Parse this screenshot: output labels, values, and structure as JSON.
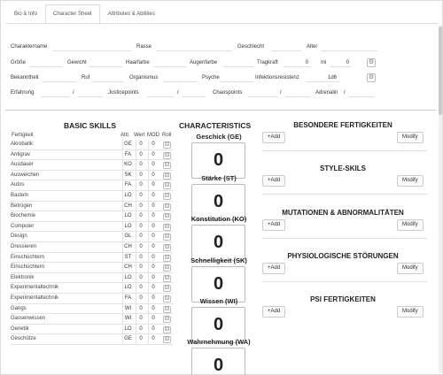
{
  "tabs": [
    "Bio & Info",
    "Character Sheet",
    "Attributes & Abilities"
  ],
  "fields": {
    "row1": [
      "Charaktername",
      "Rasse",
      "Geschlecht",
      "Alter"
    ],
    "row2": {
      "labels": [
        "Größe",
        "Gewicht",
        "Haarfarbe",
        "Augenfarbe",
        "Tragkraft",
        "Ini"
      ],
      "tragkraft_value": "0",
      "ini_value": "0"
    },
    "row3": {
      "labels": [
        "Bekanntheit",
        "Ruf",
        "Organismus",
        "Psyche",
        "Infektionsresistenz"
      ],
      "infektion_value": "1d6"
    },
    "row4": {
      "labels": [
        "Erfahrung",
        "Justicepoints",
        "Chaospoints",
        "Adrenalin"
      ],
      "slashes": [
        "/",
        "/",
        "/",
        "/"
      ]
    }
  },
  "basic_skills": {
    "title": "BASIC SKILLS",
    "columns": [
      "Fertigkeit",
      "Attr.",
      "Wert",
      "MOD",
      "Roll"
    ],
    "rows": [
      {
        "name": "Akrobatik",
        "attr": "GE",
        "wert": "0",
        "mod": "0"
      },
      {
        "name": "Antigrav",
        "attr": "FA",
        "wert": "0",
        "mod": "0"
      },
      {
        "name": "Ausdauer",
        "attr": "KO",
        "wert": "0",
        "mod": "0"
      },
      {
        "name": "Ausweichen",
        "attr": "SK",
        "wert": "0",
        "mod": "0"
      },
      {
        "name": "Autos",
        "attr": "FA",
        "wert": "0",
        "mod": "0"
      },
      {
        "name": "Basteln",
        "attr": "LO",
        "wert": "0",
        "mod": "0"
      },
      {
        "name": "Betrügen",
        "attr": "CH",
        "wert": "0",
        "mod": "0"
      },
      {
        "name": "Biochemie",
        "attr": "LO",
        "wert": "0",
        "mod": "0"
      },
      {
        "name": "Computer",
        "attr": "LO",
        "wert": "0",
        "mod": "0"
      },
      {
        "name": "Design",
        "attr": "GL",
        "wert": "0",
        "mod": "0"
      },
      {
        "name": "Dressieren",
        "attr": "CH",
        "wert": "0",
        "mod": "0"
      },
      {
        "name": "Einschüchtern",
        "attr": "ST",
        "wert": "0",
        "mod": "0"
      },
      {
        "name": "Einschüchtern",
        "attr": "CH",
        "wert": "0",
        "mod": "0"
      },
      {
        "name": "Elektronik",
        "attr": "LO",
        "wert": "0",
        "mod": "0"
      },
      {
        "name": "Experimentaltechnik",
        "attr": "LO",
        "wert": "0",
        "mod": "0"
      },
      {
        "name": "Experimentaltechnik",
        "attr": "FA",
        "wert": "0",
        "mod": "0"
      },
      {
        "name": "Gangs",
        "attr": "WI",
        "wert": "0",
        "mod": "0"
      },
      {
        "name": "Gassenwissen",
        "attr": "WI",
        "wert": "0",
        "mod": "0"
      },
      {
        "name": "Genetik",
        "attr": "LO",
        "wert": "0",
        "mod": "0"
      },
      {
        "name": "Geschütze",
        "attr": "GE",
        "wert": "0",
        "mod": "0"
      }
    ]
  },
  "characteristics": {
    "title": "CHARACTERISTICS",
    "items": [
      {
        "label": "Geschick (GE)",
        "value": "0"
      },
      {
        "label": "Stärke (ST)",
        "value": "0"
      },
      {
        "label": "Konstitution (KO)",
        "value": "0"
      },
      {
        "label": "Schnelligkeit (SK)",
        "value": "0"
      },
      {
        "label": "Wissen (WI)",
        "value": "0"
      },
      {
        "label": "Wahrnehmung (WA)",
        "value": "0"
      }
    ]
  },
  "right_sections": [
    {
      "title": "BESONDERE FERTIGKEITEN",
      "add": "+Add",
      "modify": "Modify"
    },
    {
      "title": "STYLE-SKILS",
      "add": "+Add",
      "modify": "Modify"
    },
    {
      "title": "MUTATIONEN & ABNORMALITÄTEN",
      "add": "+Add",
      "modify": "Modify"
    },
    {
      "title": "PHYSIOLOGISCHE STÖRUNGEN",
      "add": "+Add",
      "modify": "Modify"
    },
    {
      "title": "PSI FERTIGKEITEN",
      "add": "+Add",
      "modify": "Modify"
    }
  ],
  "icons": {
    "roll": "dice-icon",
    "settings": "gear-icon"
  }
}
